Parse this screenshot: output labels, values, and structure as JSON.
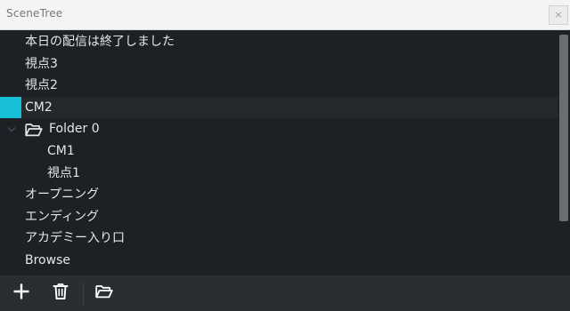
{
  "window": {
    "title": "SceneTree",
    "close_label": "×"
  },
  "tree": {
    "items": [
      {
        "label": "本日の配信は終了しました",
        "depth": 0
      },
      {
        "label": "視点3",
        "depth": 0
      },
      {
        "label": "視点2",
        "depth": 0
      },
      {
        "label": "CM2",
        "depth": 0,
        "selected": true
      },
      {
        "label": "Folder 0",
        "depth": 0,
        "type": "folder",
        "expanded": true,
        "icon": "folder-open-icon"
      },
      {
        "label": "CM1",
        "depth": 1
      },
      {
        "label": "視点1",
        "depth": 1
      },
      {
        "label": "オープニング",
        "depth": 0
      },
      {
        "label": "エンディング",
        "depth": 0
      },
      {
        "label": "アカデミー入り口",
        "depth": 0
      },
      {
        "label": "Browse",
        "depth": 0
      }
    ]
  },
  "toolbar": {
    "buttons": [
      {
        "name": "add-button",
        "icon": "plus-icon"
      },
      {
        "name": "delete-button",
        "icon": "trash-icon"
      },
      {
        "name": "add-folder-button",
        "icon": "folder-open-icon"
      }
    ]
  },
  "colors": {
    "background": "#1d2024",
    "selection_accent": "#17bfd6",
    "selected_row": "#25292e",
    "toolbar": "#2a2e32",
    "text": "#e6e6e6"
  }
}
